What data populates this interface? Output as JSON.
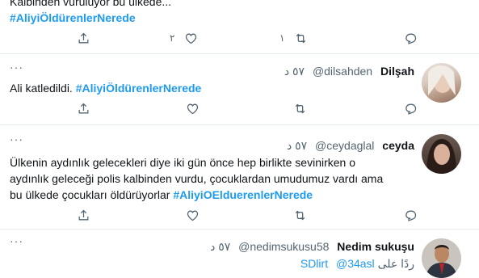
{
  "tweets": [
    {
      "text_lines": [
        "Kalbinden vuruluyor bu ülkede..."
      ],
      "hashtag": "#AliyiÖldürenlerNerede",
      "reply_count": "",
      "retweet_count": "١",
      "like_count": "٢"
    },
    {
      "name": "Dilşah",
      "handle": "@dilsahden",
      "time": "٥٧ د",
      "text": "Ali katledildi.",
      "hashtag": "#AliyiÖldürenlerNerede"
    },
    {
      "name": "ceyda",
      "handle": "@ceydaglal",
      "time": "٥٧ د",
      "text_lines": [
        "Ülkenin aydınlık gelecekleri diye iki gün önce hep birlikte sevinirken o",
        "aydınlık geleceği polis kalbinden vurdu, çocuklardan umudumuz vardı ama",
        "bu ülkede çocukları öldürüyorlar"
      ],
      "hashtag": "#AliyiOElduerenlerNerede"
    },
    {
      "name": "Nedim sukuşu",
      "handle": "@nedimsukusu58",
      "time": "٥٧ د",
      "partial_text": "ردًا على",
      "mention1": "@34asl",
      "mention2": "SDlirt"
    }
  ]
}
